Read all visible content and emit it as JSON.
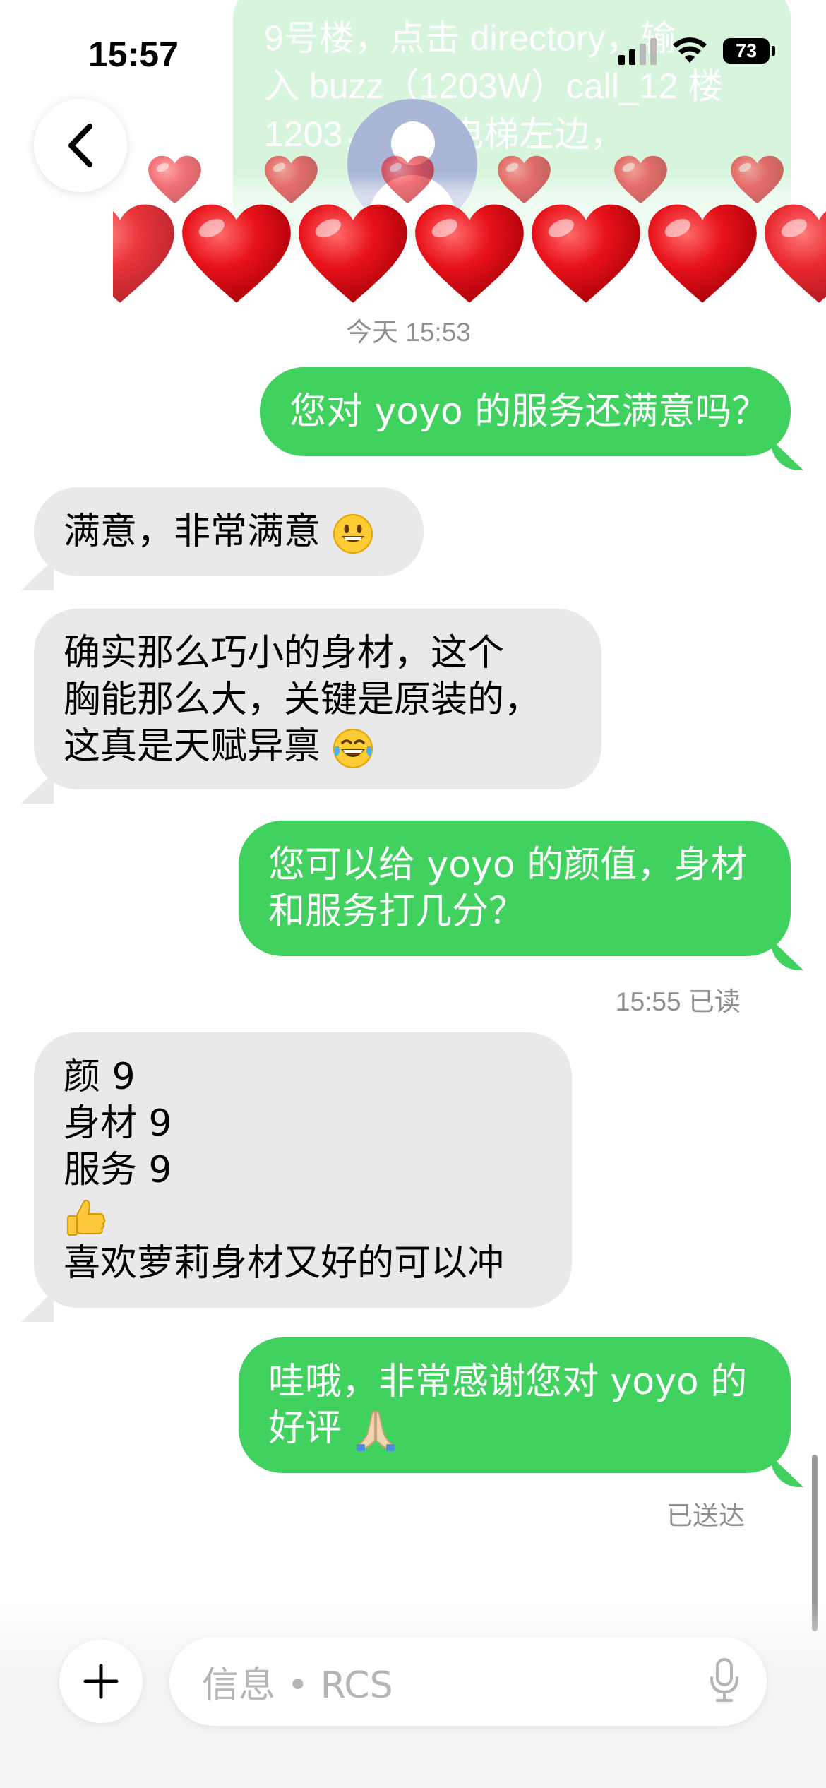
{
  "status_bar": {
    "time": "15:57",
    "battery": "73"
  },
  "previous_message": {
    "lines": [
      "9号楼，点击 directory，输",
      "入 buzz（1203W）call_12 楼",
      "1203，下了电梯左边，"
    ]
  },
  "timestamps": {
    "day_time": "今天 15:53",
    "read_receipt": "15:55 已读",
    "delivered": "已送达"
  },
  "messages": [
    {
      "direction": "outgoing",
      "lines": [
        "您对 yoyo 的服务还满意吗？"
      ]
    },
    {
      "direction": "incoming",
      "lines": [
        "满意，非常满意"
      ],
      "trailing_emoji": "grinning-face"
    },
    {
      "direction": "incoming",
      "lines": [
        "确实那么巧小的身材，这个",
        "胸能那么大，关键是原装的，",
        "这真是天赋异禀"
      ],
      "trailing_emoji": "tears-of-joy-face"
    },
    {
      "direction": "outgoing",
      "lines": [
        "您可以给 yoyo 的颜值，身材",
        "和服务打几分？"
      ]
    },
    {
      "direction": "incoming",
      "lines": [
        "颜 9",
        "身材 9",
        "服务 9",
        "",
        "喜欢萝莉身材又好的可以冲"
      ],
      "inline_emoji": "thumbs-up"
    },
    {
      "direction": "outgoing",
      "lines": [
        "哇哦，非常感谢您对 yoyo 的",
        "好评"
      ],
      "trailing_emoji": "folded-hands"
    }
  ],
  "input": {
    "placeholder": "信息 • RCS"
  },
  "icons": {
    "back": "chevron-left-icon",
    "add": "plus-icon",
    "mic": "microphone-icon",
    "signal": "cellular-signal-icon",
    "wifi": "wifi-icon",
    "battery": "battery-icon",
    "effect": "heart-icon"
  },
  "colors": {
    "outgoing_bubble": "#41d15f",
    "incoming_bubble": "#e9e9eb",
    "timestamp_text": "#8e8e93",
    "effect_heart": "#e8121a"
  }
}
